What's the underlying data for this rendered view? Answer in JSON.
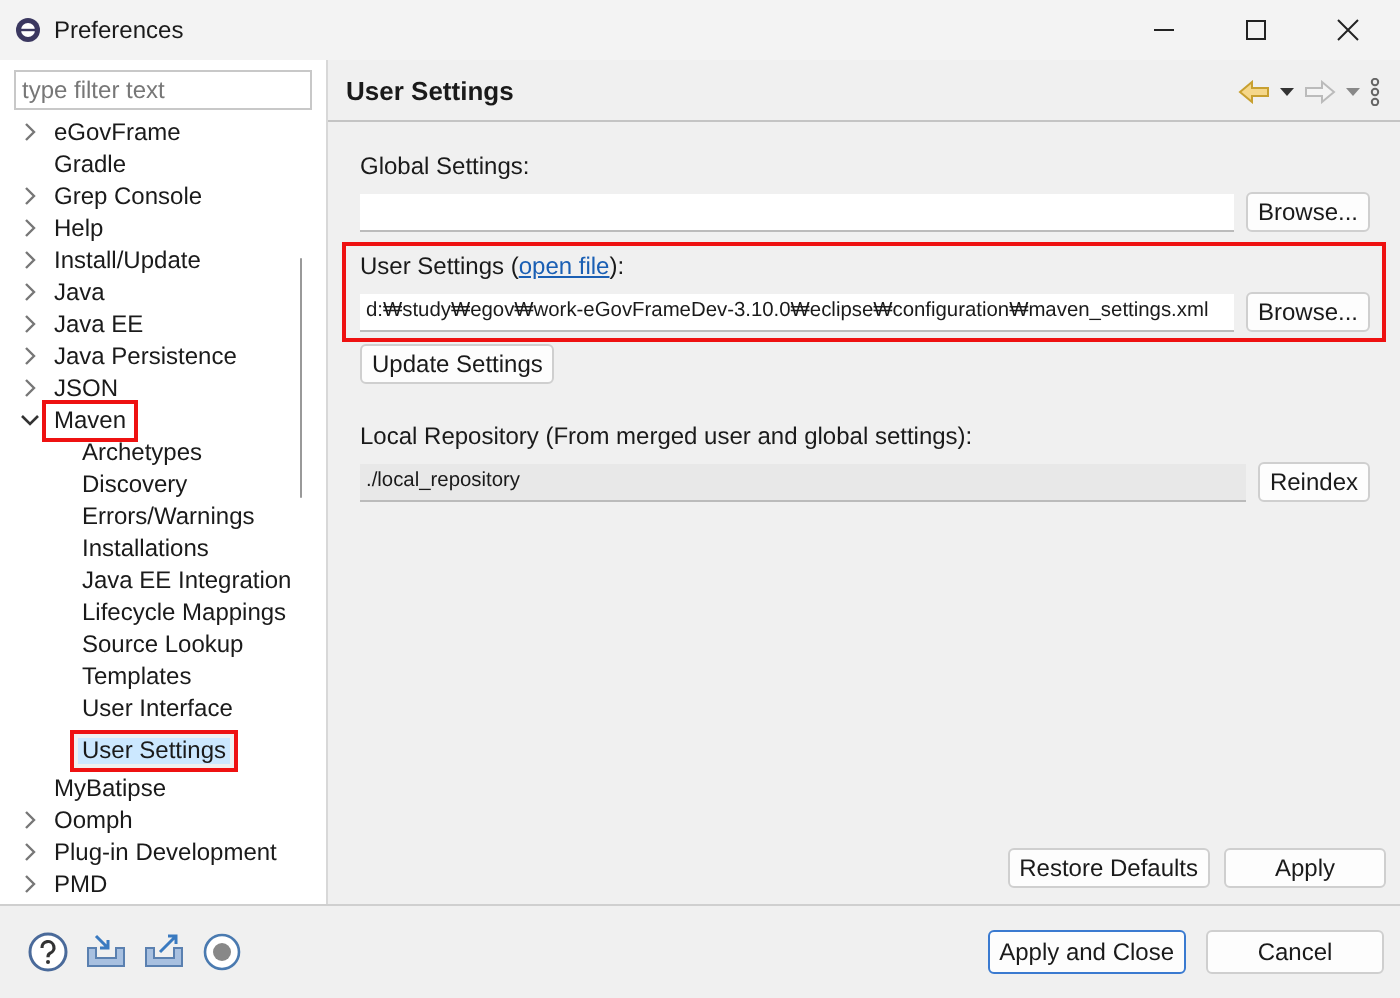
{
  "window": {
    "title": "Preferences"
  },
  "filter": {
    "placeholder": "type filter text"
  },
  "tree": [
    {
      "label": "eGovFrame",
      "kind": "folder",
      "expanded": false,
      "selected": false,
      "annotated": false
    },
    {
      "label": "Gradle",
      "kind": "leaf",
      "selected": false,
      "annotated": false
    },
    {
      "label": "Grep Console",
      "kind": "folder",
      "expanded": false,
      "selected": false,
      "annotated": false
    },
    {
      "label": "Help",
      "kind": "folder",
      "expanded": false,
      "selected": false,
      "annotated": false
    },
    {
      "label": "Install/Update",
      "kind": "folder",
      "expanded": false,
      "selected": false,
      "annotated": false
    },
    {
      "label": "Java",
      "kind": "folder",
      "expanded": false,
      "selected": false,
      "annotated": false
    },
    {
      "label": "Java EE",
      "kind": "folder",
      "expanded": false,
      "selected": false,
      "annotated": false
    },
    {
      "label": "Java Persistence",
      "kind": "folder",
      "expanded": false,
      "selected": false,
      "annotated": false
    },
    {
      "label": "JSON",
      "kind": "folder",
      "expanded": false,
      "selected": false,
      "annotated": false
    },
    {
      "label": "Maven",
      "kind": "folder",
      "expanded": true,
      "selected": false,
      "annotated": true,
      "children": [
        {
          "label": "Archetypes",
          "kind": "leaf",
          "selected": false,
          "annotated": false
        },
        {
          "label": "Discovery",
          "kind": "leaf",
          "selected": false,
          "annotated": false
        },
        {
          "label": "Errors/Warnings",
          "kind": "leaf",
          "selected": false,
          "annotated": false
        },
        {
          "label": "Installations",
          "kind": "leaf",
          "selected": false,
          "annotated": false
        },
        {
          "label": "Java EE Integration",
          "kind": "leaf",
          "selected": false,
          "annotated": false
        },
        {
          "label": "Lifecycle Mappings",
          "kind": "leaf",
          "selected": false,
          "annotated": false
        },
        {
          "label": "Source Lookup",
          "kind": "leaf",
          "selected": false,
          "annotated": false
        },
        {
          "label": "Templates",
          "kind": "leaf",
          "selected": false,
          "annotated": false
        },
        {
          "label": "User Interface",
          "kind": "leaf",
          "selected": false,
          "annotated": false
        },
        {
          "label": "User Settings",
          "kind": "leaf",
          "selected": true,
          "annotated": true
        }
      ]
    },
    {
      "label": "MyBatipse",
      "kind": "leaf",
      "selected": false,
      "annotated": false
    },
    {
      "label": "Oomph",
      "kind": "folder",
      "expanded": false,
      "selected": false,
      "annotated": false
    },
    {
      "label": "Plug-in Development",
      "kind": "folder",
      "expanded": false,
      "selected": false,
      "annotated": false
    },
    {
      "label": "PMD",
      "kind": "folder",
      "expanded": false,
      "selected": false,
      "annotated": false
    }
  ],
  "page": {
    "title": "User Settings",
    "global": {
      "label": "Global Settings:",
      "button": "Browse..."
    },
    "user": {
      "label": "User Settings (",
      "link": "open file",
      "label_end": "):",
      "value": "d:₩study₩egov₩work-eGovFrameDev-3.10.0₩eclipse₩configuration₩maven_settings.xml",
      "button": "Browse...",
      "annotated": true
    },
    "update_button": "Update Settings",
    "local": {
      "label": "Local Repository (From merged user and global settings):",
      "value": "./local_repository",
      "button": "Reindex"
    },
    "restore_button": "Restore Defaults",
    "apply_button": "Apply"
  },
  "footer": {
    "apply_close_button": "Apply and Close",
    "cancel_button": "Cancel"
  }
}
